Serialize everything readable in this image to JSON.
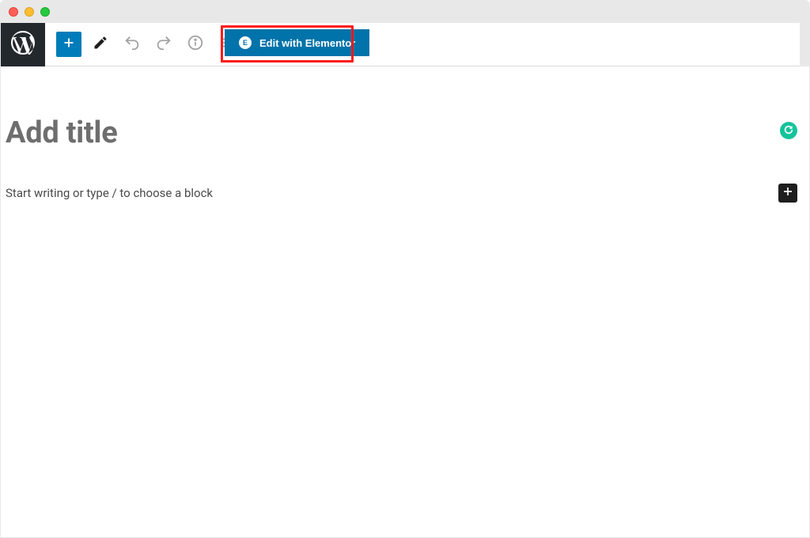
{
  "toolbar": {
    "add_block_tooltip": "Add block",
    "edit_tooltip": "Tools",
    "undo_tooltip": "Undo",
    "redo_tooltip": "Redo",
    "info_tooltip": "Details",
    "outline_tooltip": "Outline",
    "elementor_button_label": "Edit with Elementor",
    "elementor_icon_char": "E"
  },
  "editor": {
    "title_placeholder": "Add title",
    "body_placeholder": "Start writing or type / to choose a block"
  },
  "integrations": {
    "grammarly_name": "Grammarly"
  },
  "icons": {
    "wp_logo": "wordpress-logo-icon",
    "plus": "plus-icon",
    "pencil": "pencil-icon",
    "undo": "undo-icon",
    "redo": "redo-icon",
    "info": "info-icon",
    "list": "outline-icon",
    "add_block_inline": "plus-icon",
    "grammarly": "grammarly-icon"
  }
}
